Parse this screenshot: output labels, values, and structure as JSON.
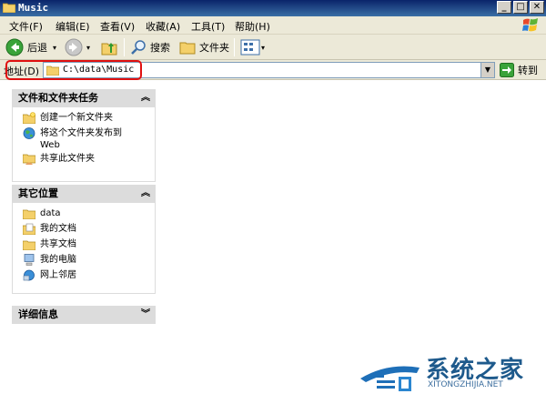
{
  "window": {
    "title": "Music",
    "buttons": {
      "minimize": "_",
      "maximize": "□",
      "close": "✕"
    }
  },
  "menu": [
    "文件(F)",
    "编辑(E)",
    "查看(V)",
    "收藏(A)",
    "工具(T)",
    "帮助(H)"
  ],
  "toolbar": {
    "back": "后退",
    "search": "搜索",
    "folders": "文件夹"
  },
  "address": {
    "label": "地址(D)",
    "value": "C:\\data\\Music",
    "go": "转到"
  },
  "tasks_panel": {
    "title": "文件和文件夹任务",
    "items": [
      "创建一个新文件夹",
      "将这个文件夹发布到 Web",
      "共享此文件夹"
    ]
  },
  "places_panel": {
    "title": "其它位置",
    "items": [
      "data",
      "我的文档",
      "共享文档",
      "我的电脑",
      "网上邻居"
    ]
  },
  "details_panel": {
    "title": "详细信息"
  },
  "watermark": {
    "title": "系统之家",
    "url": "XITONGZHIJIA.NET"
  },
  "colors": {
    "title_bar": "#0a246a",
    "highlight": "#e01010",
    "panel_header": "#dcdcdc"
  }
}
